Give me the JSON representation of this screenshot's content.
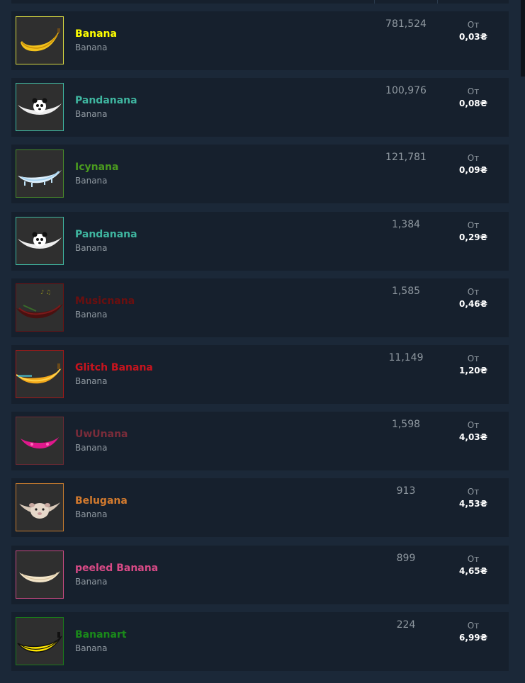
{
  "listings": [
    {
      "name": "Banana",
      "game": "Banana",
      "quantity": "781,524",
      "from_label": "От",
      "price": "0,03₴",
      "name_color": "#ffff00",
      "border_color": "#d8d840",
      "icon": "banana-icon"
    },
    {
      "name": "Pandanana",
      "game": "Banana",
      "quantity": "100,976",
      "from_label": "От",
      "price": "0,08₴",
      "name_color": "#3fb6a0",
      "border_color": "#3fb6a0",
      "icon": "panda-banana-icon"
    },
    {
      "name": "Icynana",
      "game": "Banana",
      "quantity": "121,781",
      "from_label": "От",
      "price": "0,09₴",
      "name_color": "#4a9a1f",
      "border_color": "#4a8a2a",
      "icon": "icy-banana-icon"
    },
    {
      "name": "Pandanana",
      "game": "Banana",
      "quantity": "1,384",
      "from_label": "От",
      "price": "0,29₴",
      "name_color": "#3fb6a0",
      "border_color": "#3fb6a0",
      "icon": "panda-banana-icon"
    },
    {
      "name": "Musicnana",
      "game": "Banana",
      "quantity": "1,585",
      "from_label": "От",
      "price": "0,46₴",
      "name_color": "#6a0f0f",
      "border_color": "#6a1414",
      "icon": "music-banana-icon"
    },
    {
      "name": "Glitch Banana",
      "game": "Banana",
      "quantity": "11,149",
      "from_label": "От",
      "price": "1,20₴",
      "name_color": "#c8141e",
      "border_color": "#a01818",
      "icon": "glitch-banana-icon"
    },
    {
      "name": "UwUnana",
      "game": "Banana",
      "quantity": "1,598",
      "from_label": "От",
      "price": "4,03₴",
      "name_color": "#7a2c3a",
      "border_color": "#6a2a34",
      "icon": "uwu-banana-icon"
    },
    {
      "name": "Belugana",
      "game": "Banana",
      "quantity": "913",
      "from_label": "От",
      "price": "4,53₴",
      "name_color": "#d27a2e",
      "border_color": "#c47a2e",
      "icon": "beluga-banana-icon"
    },
    {
      "name": "peeled Banana",
      "game": "Banana",
      "quantity": "899",
      "from_label": "От",
      "price": "4,65₴",
      "name_color": "#d84a86",
      "border_color": "#c84a80",
      "icon": "peeled-banana-icon"
    },
    {
      "name": "Bananart",
      "game": "Banana",
      "quantity": "224",
      "from_label": "От",
      "price": "6,99₴",
      "name_color": "#1a8a1a",
      "border_color": "#1a7a1a",
      "icon": "bananart-icon"
    }
  ]
}
